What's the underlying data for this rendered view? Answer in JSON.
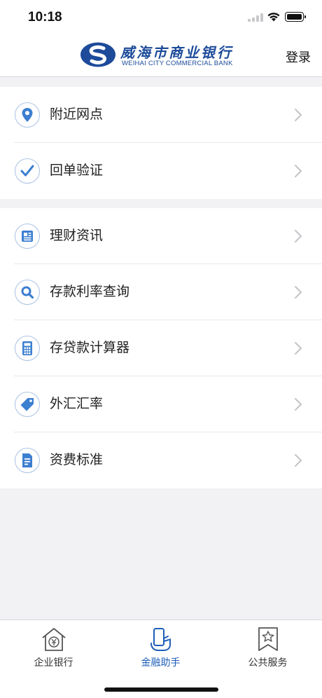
{
  "status_bar": {
    "time": "10:18"
  },
  "header": {
    "logo_cn": "威海市商业银行",
    "logo_en": "WEIHAI CITY COMMERCIAL BANK",
    "login_label": "登录"
  },
  "colors": {
    "accent": "#1d5fb8",
    "icon_blue": "#3d7fd0",
    "separator": "#e8e8ec",
    "background": "#f2f2f4"
  },
  "sections": [
    {
      "items": [
        {
          "label": "附近网点",
          "icon": "location-pin-icon"
        },
        {
          "label": "回单验证",
          "icon": "checkmark-icon"
        }
      ]
    },
    {
      "items": [
        {
          "label": "理财资讯",
          "icon": "newspaper-icon"
        },
        {
          "label": "存款利率查询",
          "icon": "search-icon"
        },
        {
          "label": "存贷款计算器",
          "icon": "calculator-icon"
        },
        {
          "label": "外汇汇率",
          "icon": "price-tag-icon"
        },
        {
          "label": "资费标准",
          "icon": "document-icon"
        }
      ]
    }
  ],
  "tab_bar": {
    "tabs": [
      {
        "label": "企业银行",
        "icon": "bank-house-icon",
        "active": false
      },
      {
        "label": "金融助手",
        "icon": "phone-hand-icon",
        "active": true
      },
      {
        "label": "公共服务",
        "icon": "star-bookmark-icon",
        "active": false
      }
    ]
  }
}
